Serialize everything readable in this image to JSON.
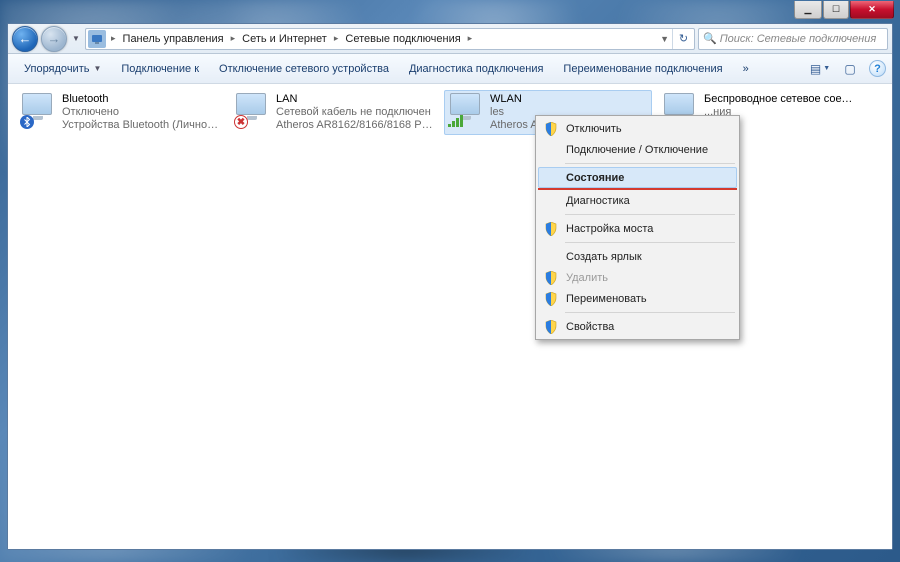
{
  "titlebar": {
    "minimize": "▁",
    "maximize": "☐",
    "close": "✕"
  },
  "nav": {
    "back_glyph": "←",
    "forward_glyph": "→",
    "dropdown_glyph": "▼",
    "refresh_glyph": "↻"
  },
  "breadcrumb": {
    "arrow": "▸",
    "segments": [
      "Панель управления",
      "Сеть и Интернет",
      "Сетевые подключения"
    ]
  },
  "search": {
    "icon": "🔍",
    "placeholder": "Поиск: Сетевые подключения"
  },
  "toolbar": {
    "organize": "Упорядочить",
    "connect": "Подключение к",
    "disable": "Отключение сетевого устройства",
    "diagnose": "Диагностика подключения",
    "rename": "Переименование подключения",
    "more": "»",
    "dd": "▼",
    "view_glyph": "▤",
    "preview_glyph": "▢",
    "help_glyph": "?"
  },
  "connections": [
    {
      "name": "Bluetooth",
      "line2": "Отключено",
      "line3": "Устройства Bluetooth (Личное с...",
      "overlay": "bt"
    },
    {
      "name": "LAN",
      "line2": "Сетевой кабель не подключен",
      "line3": "Atheros AR8162/8166/8168 PCI-E ...",
      "overlay": "x"
    },
    {
      "name": "WLAN",
      "line2": "les",
      "line3": "Atheros AR92...",
      "overlay": "sig",
      "selected": true
    },
    {
      "name": "Беспроводное сетевое соединение",
      "line2": "",
      "line3": "...ния",
      "overlay": "sig"
    }
  ],
  "context_menu": {
    "items": [
      {
        "label": "Отключить",
        "icon": "shield"
      },
      {
        "label": "Подключение / Отключение"
      },
      {
        "sep": true
      },
      {
        "label": "Состояние",
        "hover": true,
        "redline_below": true
      },
      {
        "label": "Диагностика"
      },
      {
        "sep": true
      },
      {
        "label": "Настройка моста",
        "icon": "shield"
      },
      {
        "sep": true
      },
      {
        "label": "Создать ярлык"
      },
      {
        "label": "Удалить",
        "disabled": true,
        "icon": "shield"
      },
      {
        "label": "Переименовать",
        "icon": "shield"
      },
      {
        "sep": true
      },
      {
        "label": "Свойства",
        "icon": "shield"
      }
    ]
  }
}
